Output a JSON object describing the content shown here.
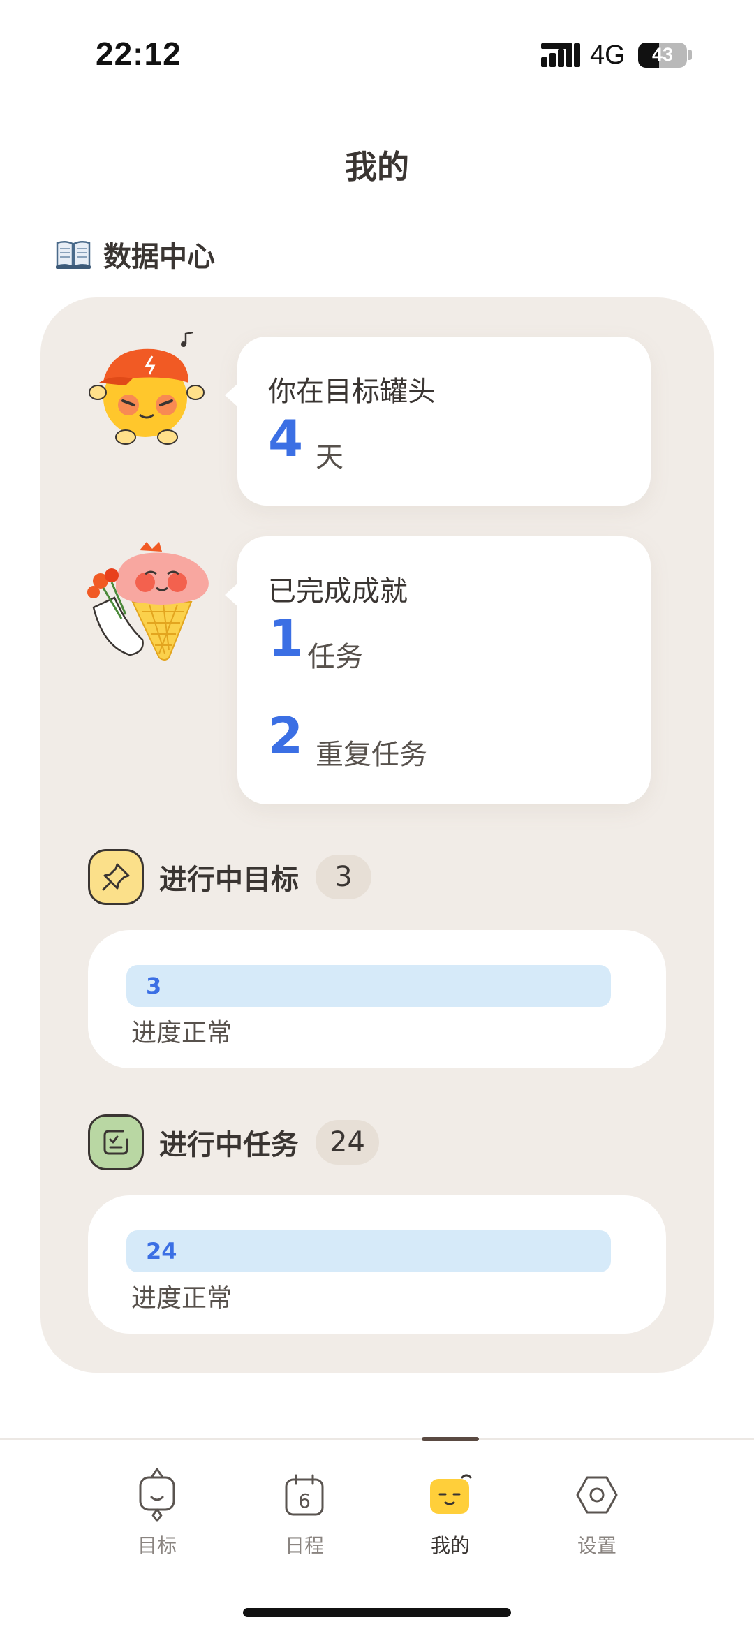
{
  "status_bar": {
    "time": "22:12",
    "network": "4G",
    "battery": "43",
    "battery_level": 0.43
  },
  "page": {
    "title": "我的"
  },
  "data_center": {
    "icon": "open-book-icon",
    "heading": "数据中心"
  },
  "stats": {
    "days": {
      "caption": "你在目标罐头",
      "value": "4",
      "unit": "天"
    },
    "achievements": {
      "caption": "已完成成就",
      "tasks_value": "1",
      "tasks_unit": "任务",
      "repeat_value": "2",
      "repeat_unit": "重复任务"
    }
  },
  "goals": {
    "icon": "pushpin-icon",
    "title": "进行中目标",
    "count": "3",
    "progress": {
      "value": "3",
      "label": "进度正常"
    }
  },
  "tasks": {
    "icon": "checklist-icon",
    "title": "进行中任务",
    "count": "24",
    "progress": {
      "value": "24",
      "label": "进度正常"
    }
  },
  "tabs": [
    {
      "label": "目标",
      "icon": "goal-mascot-icon",
      "active": false
    },
    {
      "label": "日程",
      "icon": "calendar-icon",
      "active": false
    },
    {
      "label": "我的",
      "icon": "profile-mascot-icon",
      "active": true
    },
    {
      "label": "设置",
      "icon": "settings-hexagon-icon",
      "active": false
    }
  ],
  "colors": {
    "accent": "#3b6fe4",
    "panel": "#f1ece7",
    "progress_track": "#d6eaf9",
    "goal_icon_bg": "#fbe08a",
    "task_icon_bg": "#b9d7a3"
  }
}
